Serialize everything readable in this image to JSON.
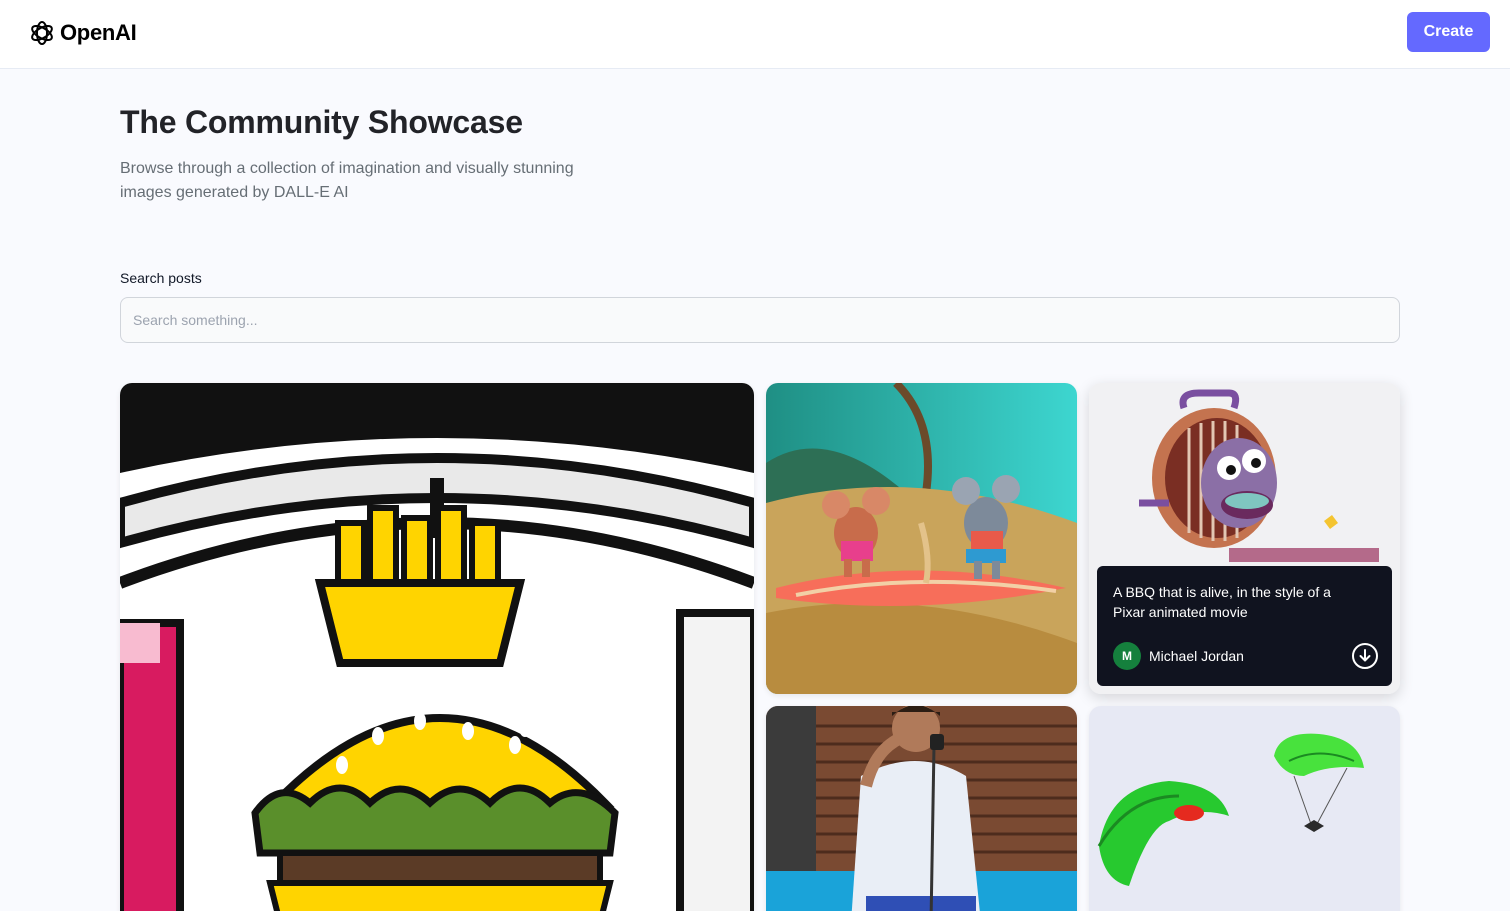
{
  "header": {
    "brand": "OpenAI",
    "create_label": "Create",
    "accent_color": "#6469ff"
  },
  "hero": {
    "title": "The Community Showcase",
    "subtitle": "Browse through a collection of imagination and visually stunning images generated by DALL-E AI"
  },
  "search": {
    "label": "Search posts",
    "placeholder": "Search something...",
    "value": ""
  },
  "posts": [
    {
      "image": "stained-glass-burger-fries"
    },
    {
      "image": "mice-surfing"
    },
    {
      "image": "alive-bbq-grill",
      "prompt": "A BBQ that is alive, in the style of a Pixar animated movie",
      "author": "Michael Jordan",
      "author_initial": "M",
      "download_icon": "download-icon"
    },
    {
      "image": "man-singing-microphone"
    },
    {
      "image": "green-parachutes"
    }
  ]
}
